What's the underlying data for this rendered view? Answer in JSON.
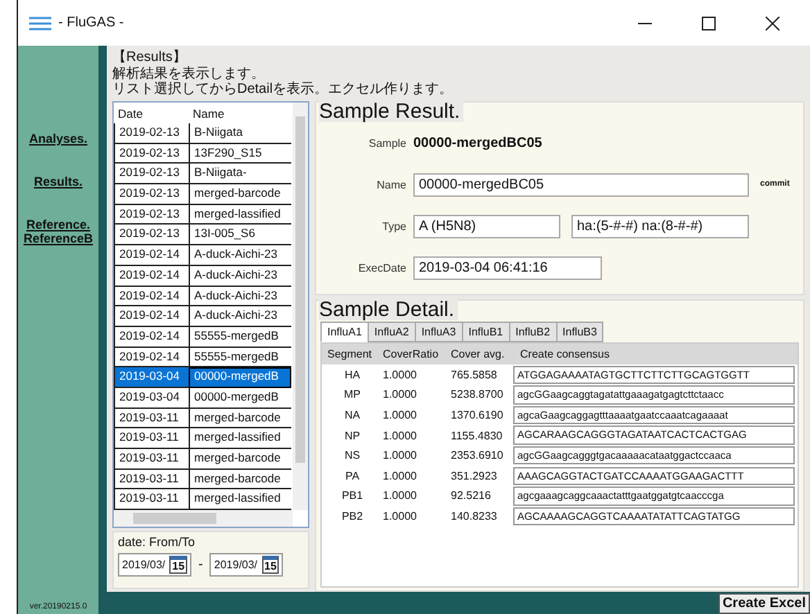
{
  "window": {
    "title": "- FluGAS -"
  },
  "sidebar": {
    "items": [
      "Analyses.",
      "Results.",
      "Reference.",
      "ReferenceB"
    ],
    "version": "ver.20190215.0"
  },
  "header": {
    "title": "【Results】",
    "lines": [
      "解析結果を表示します。",
      "リスト選択してからDetailを表示。エクセル作ります。"
    ]
  },
  "results_list": {
    "columns": [
      "Date",
      "Name"
    ],
    "rows": [
      {
        "date": "2019-02-13",
        "name": "B-Niigata",
        "selected": false
      },
      {
        "date": "2019-02-13",
        "name": "13F290_S15",
        "selected": false
      },
      {
        "date": "2019-02-13",
        "name": "B-Niigata-",
        "selected": false
      },
      {
        "date": "2019-02-13",
        "name": "merged-barcode",
        "selected": false
      },
      {
        "date": "2019-02-13",
        "name": "merged-lassified",
        "selected": false
      },
      {
        "date": "2019-02-13",
        "name": "13I-005_S6",
        "selected": false
      },
      {
        "date": "2019-02-14",
        "name": "A-duck-Aichi-23",
        "selected": false
      },
      {
        "date": "2019-02-14",
        "name": "A-duck-Aichi-23",
        "selected": false
      },
      {
        "date": "2019-02-14",
        "name": "A-duck-Aichi-23",
        "selected": false
      },
      {
        "date": "2019-02-14",
        "name": "A-duck-Aichi-23",
        "selected": false
      },
      {
        "date": "2019-02-14",
        "name": "55555-mergedB",
        "selected": false
      },
      {
        "date": "2019-02-14",
        "name": "55555-mergedB",
        "selected": false
      },
      {
        "date": "2019-03-04",
        "name": "00000-mergedB",
        "selected": true
      },
      {
        "date": "2019-03-04",
        "name": "00000-mergedB",
        "selected": false
      },
      {
        "date": "2019-03-11",
        "name": "merged-barcode",
        "selected": false
      },
      {
        "date": "2019-03-11",
        "name": "merged-lassified",
        "selected": false
      },
      {
        "date": "2019-03-11",
        "name": "merged-barcode",
        "selected": false
      },
      {
        "date": "2019-03-11",
        "name": "merged-barcode",
        "selected": false
      },
      {
        "date": "2019-03-11",
        "name": "merged-lassified",
        "selected": false
      }
    ]
  },
  "date_filter": {
    "label": "date: From/To",
    "from": {
      "value": "2019/03/",
      "day": "15"
    },
    "separator": "-",
    "to": {
      "value": "2019/03/",
      "day": "15"
    }
  },
  "sample_result": {
    "title": "Sample Result.",
    "sample_label": "Sample",
    "sample_value": "00000-mergedBC05",
    "name_label": "Name",
    "name_value": "00000-mergedBC05",
    "commit": "commit",
    "type_label": "Type",
    "type_value": "A (H5N8)",
    "subtype_value": "ha:(5-#-#) na:(8-#-#)",
    "exec_label": "ExecDate",
    "exec_value": "2019-03-04 06:41:16"
  },
  "sample_detail": {
    "title": "Sample Detail.",
    "tabs": [
      {
        "label": "InfluA1",
        "selected": true
      },
      {
        "label": "InfluA2",
        "selected": false
      },
      {
        "label": "InfluA3",
        "selected": false
      },
      {
        "label": "InfluB1",
        "selected": false
      },
      {
        "label": "InfluB2",
        "selected": false
      },
      {
        "label": "InfluB3",
        "selected": false
      }
    ],
    "columns": [
      "Segment",
      "CoverRatio",
      "Cover avg.",
      "Create consensus"
    ],
    "rows": [
      {
        "segment": "HA",
        "ratio": "1.0000",
        "avg": "765.5858",
        "consensus": "ATGGAGAAAATAGTGCTTCTTCTTGCAGTGGTT"
      },
      {
        "segment": "MP",
        "ratio": "1.0000",
        "avg": "5238.8700",
        "consensus": "agcGGaagcaggtagatattgaaagatgagtcttctaacc"
      },
      {
        "segment": "NA",
        "ratio": "1.0000",
        "avg": "1370.6190",
        "consensus": "agcaGaagcaggagtttaaaatgaatccaaatcagaaaat"
      },
      {
        "segment": "NP",
        "ratio": "1.0000",
        "avg": "1155.4830",
        "consensus": "AGCARAAGCAGGGTAGATAATCACTCACTGAG"
      },
      {
        "segment": "NS",
        "ratio": "1.0000",
        "avg": "2353.6910",
        "consensus": "agcGGaagcagggtgacaaaaacataatggactccaaca"
      },
      {
        "segment": "PA",
        "ratio": "1.0000",
        "avg": "351.2923",
        "consensus": "AAAGCAGGTACTGATCCAAAATGGAAGACTTT"
      },
      {
        "segment": "PB1",
        "ratio": "1.0000",
        "avg": "92.5216",
        "consensus": "agcgaaagcaggcaaactatttgaatggatgtcaacccga"
      },
      {
        "segment": "PB2",
        "ratio": "1.0000",
        "avg": "140.8233",
        "consensus": "AGCAAAAGCAGGTCAAAATATATTCAGTATGG"
      }
    ]
  },
  "footer": {
    "button": "Create Excel"
  }
}
